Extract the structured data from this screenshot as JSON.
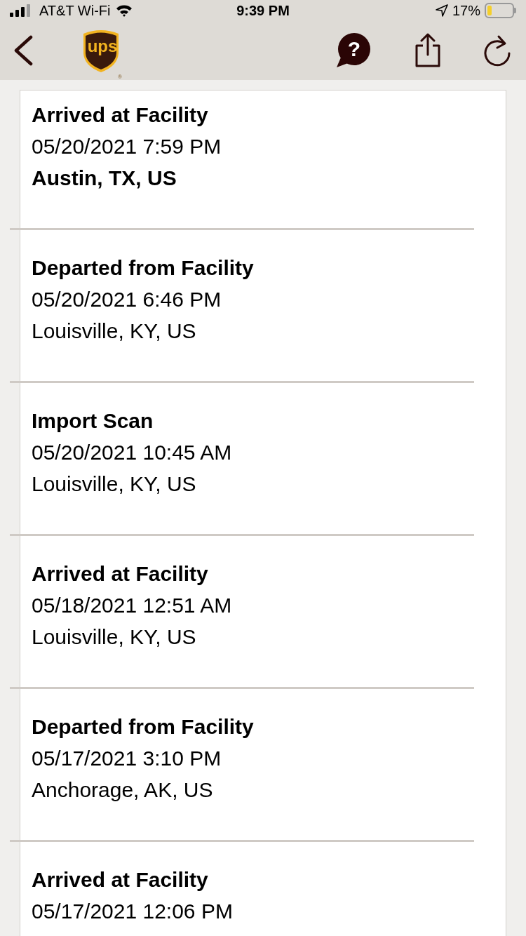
{
  "status_bar": {
    "carrier": "AT&T Wi-Fi",
    "time": "9:39 PM",
    "battery": "17%"
  },
  "nav_bar": {
    "logo": {
      "text": "ups",
      "mark": "®"
    },
    "help_glyph": "?"
  },
  "events": [
    {
      "status": "Arrived at Facility",
      "datetime": "05/20/2021 7:59 PM",
      "location": "Austin, TX, US",
      "location_bold": true
    },
    {
      "status": "Departed from Facility",
      "datetime": "05/20/2021 6:46 PM",
      "location": "Louisville, KY, US",
      "location_bold": false
    },
    {
      "status": "Import Scan",
      "datetime": "05/20/2021 10:45 AM",
      "location": "Louisville, KY, US",
      "location_bold": false
    },
    {
      "status": "Arrived at Facility",
      "datetime": "05/18/2021 12:51 AM",
      "location": "Louisville, KY, US",
      "location_bold": false
    },
    {
      "status": "Departed from Facility",
      "datetime": "05/17/2021 3:10 PM",
      "location": "Anchorage, AK, US",
      "location_bold": false
    },
    {
      "status": "Arrived at Facility",
      "datetime": "05/17/2021 12:06 PM"
    }
  ]
}
